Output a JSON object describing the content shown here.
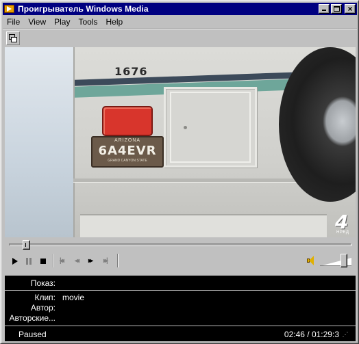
{
  "window": {
    "title": "Проигрыватель Windows Media",
    "icon": "media-player-icon"
  },
  "menu": {
    "items": [
      "File",
      "View",
      "Play",
      "Tools",
      "Help"
    ]
  },
  "toolbar": {
    "compact_mode_icon": "switch-mode-icon"
  },
  "video": {
    "rv_number": "1676",
    "plate_state": "ARIZONA",
    "plate_number": "6A4EVR",
    "plate_tagline": "GRAND CANYON STATE",
    "channel_logo": "4",
    "channel_logo_sub": "НРЕД"
  },
  "seek": {
    "position_fraction": 0.04
  },
  "volume": {
    "level_fraction": 0.82
  },
  "info": {
    "show_label": "Показ:",
    "show_value": "",
    "clip_label": "Клип:",
    "clip_value": "movie",
    "author_label": "Автор:",
    "author_value": "",
    "copyright_label": "Авторские...",
    "copyright_value": "",
    "status": "Paused",
    "time": "02:46 / 01:29:3"
  }
}
